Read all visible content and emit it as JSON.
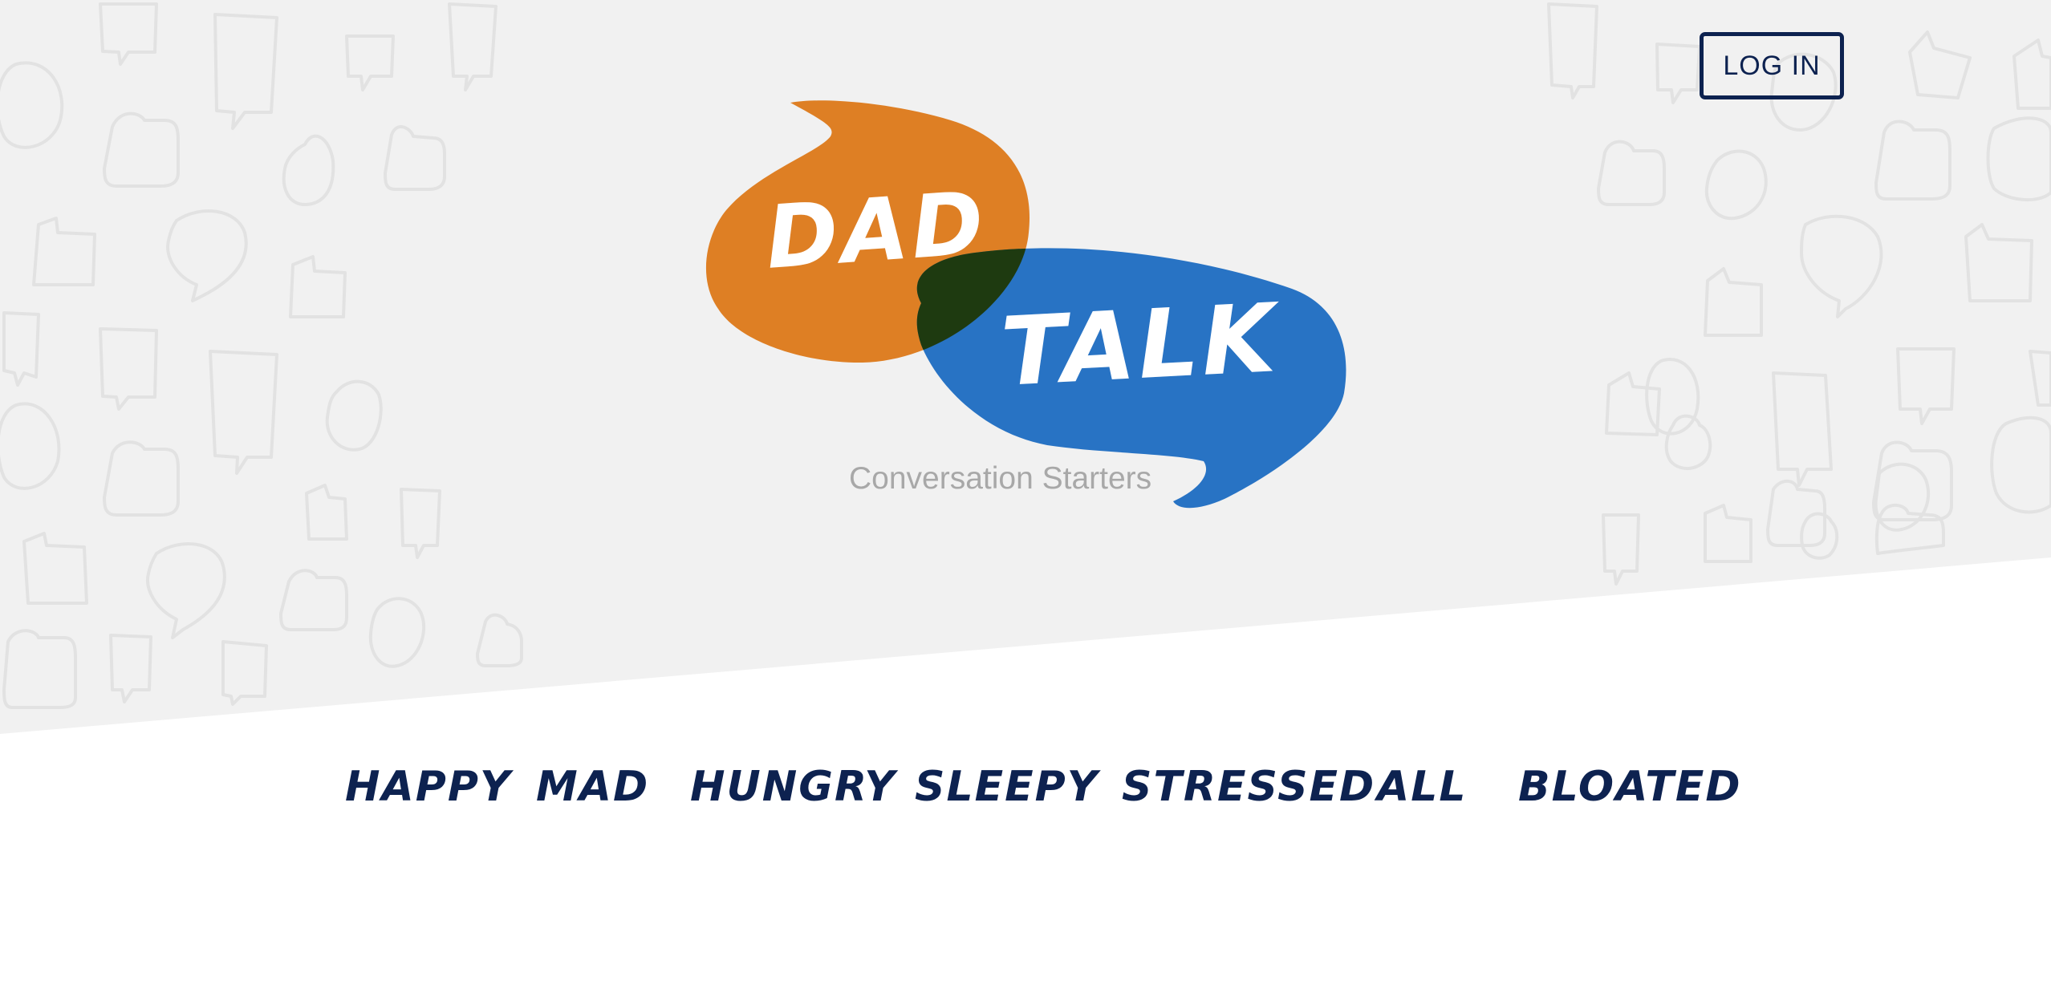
{
  "header": {
    "login_label": "LOG IN"
  },
  "logo": {
    "word_1": "DAD",
    "word_2": "TALK",
    "tagline": "Conversation Starters"
  },
  "mood_nav": {
    "items": [
      "HAPPY",
      "MAD",
      "HUNGRY",
      "SLEEPY",
      "STRESSED",
      "ALL",
      "BLOATED"
    ]
  },
  "colors": {
    "navy": "#0d2250",
    "orange_bubble": "#de7f24",
    "blue_bubble": "#2873c4",
    "overlap": "#1e3a10",
    "hero_bg": "#f1f1f1",
    "tagline_gray": "#a8a8a8"
  },
  "icons": {
    "background_pattern": "speech-bubble-icon"
  }
}
